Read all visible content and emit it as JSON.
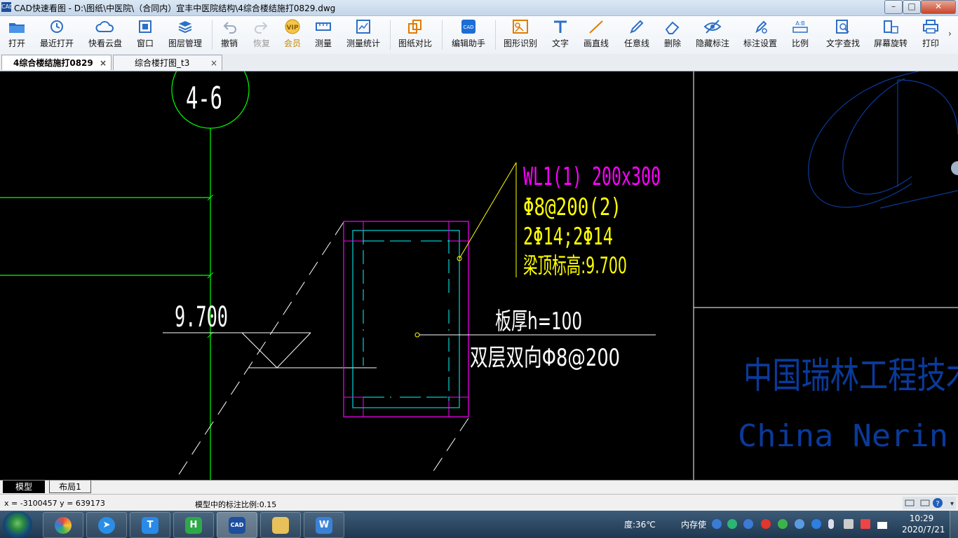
{
  "window": {
    "app_icon": "CAD",
    "title": "CAD快速看图 - D:\\图纸\\中医院\\（合同内）宜丰中医院结构\\4综合楼结施打0829.dwg",
    "controls": [
      "minimize-icon",
      "maximize-icon",
      "close-icon"
    ]
  },
  "toolbar": {
    "open": "打开",
    "recent": "最近打开",
    "cloud": "快看云盘",
    "window": "窗口",
    "layers": "图层管理",
    "undo": "撤销",
    "redo": "恢复",
    "vip": "会员",
    "measure": "测量",
    "measure_stats": "测量统计",
    "compare": "图纸对比",
    "edit_helper": "编辑助手",
    "shape_recognize": "图形识别",
    "text": "文字",
    "line": "画直线",
    "freeline": "任意线",
    "erase": "删除",
    "hide_annotation": "隐藏标注",
    "annotation_settings": "标注设置",
    "ratio": "比例",
    "text_search": "文字查找",
    "rotate_screen": "屏幕旋转",
    "print": "打印",
    "more": "›"
  },
  "tabs": [
    {
      "label": "4综合楼结施打0829",
      "active": true
    },
    {
      "label": "综合楼打图_t3",
      "active": false
    }
  ],
  "tab_close": "×",
  "drawing": {
    "grid_axis_label": "4-6",
    "beam_label_line1": "WL1(1) 200x300",
    "beam_label_line2": "Φ8@200(2)",
    "beam_label_line3": "2Φ14;2Φ14",
    "beam_label_line4": "梁顶标高:9.700",
    "elevation": "9.700",
    "slab_thickness": "板厚h=100",
    "slab_rebar": "双层双向Φ8@200",
    "company_cn": "中国瑞林工程技术",
    "company_en": "China  Nerin",
    "colors": {
      "background": "#000000",
      "grid_line": "#00ff00",
      "beam_text": "#ff00ff",
      "rebar_text": "#ffff00",
      "white_text": "#ffffff",
      "section_outline": "#ff00ff",
      "section_inner": "#00ffff",
      "logo": "#0a3a9a"
    }
  },
  "layout_tabs": {
    "model": "模型",
    "layout1": "布局1"
  },
  "status": {
    "coordinates": "x = -3100457  y = 639173",
    "annotation_scale": "模型中的标注比例:0.15"
  },
  "taskbar": {
    "temperature": "度:36℃",
    "memory": "内存使",
    "time": "10:29",
    "date": "2020/7/21",
    "apps": [
      "start-button",
      "browser",
      "messenger",
      "text-tool",
      "h-app",
      "cad-viewer",
      "file-explorer",
      "wps"
    ]
  }
}
